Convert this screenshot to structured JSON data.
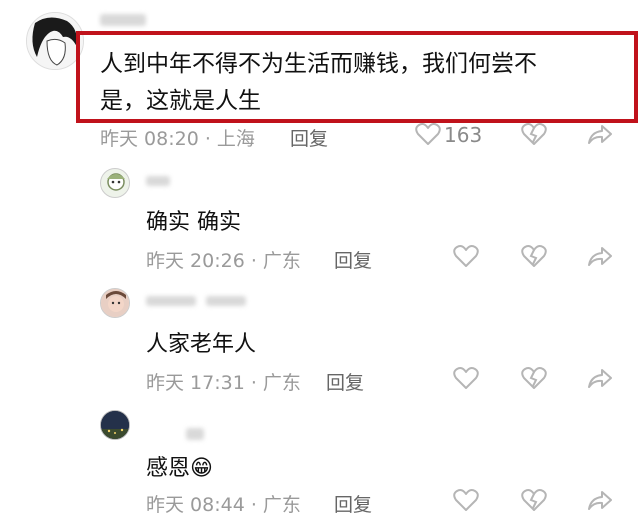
{
  "comments": [
    {
      "text_line1": "人到中年不得不为生活而赚钱，我们何尝不",
      "text_line2": "是，这就是人生",
      "meta": "昨天 08:20 · 上海",
      "reply": "回复",
      "likes": "163"
    },
    {
      "text": "确实 确实",
      "meta": "昨天 20:26 · 广东",
      "reply": "回复"
    },
    {
      "text": "人家老年人",
      "meta": "昨天 17:31 · 广东",
      "reply": "回复"
    },
    {
      "text": "感恩",
      "emoji": "😁",
      "meta": "昨天 08:44 · 广东",
      "reply": "回复"
    }
  ],
  "icons": [
    "heart-icon",
    "broken-heart-icon",
    "share-icon"
  ],
  "colors": {
    "highlight": "#c0121b",
    "meta": "#9a9a9a",
    "icon": "#b5b5b5"
  }
}
